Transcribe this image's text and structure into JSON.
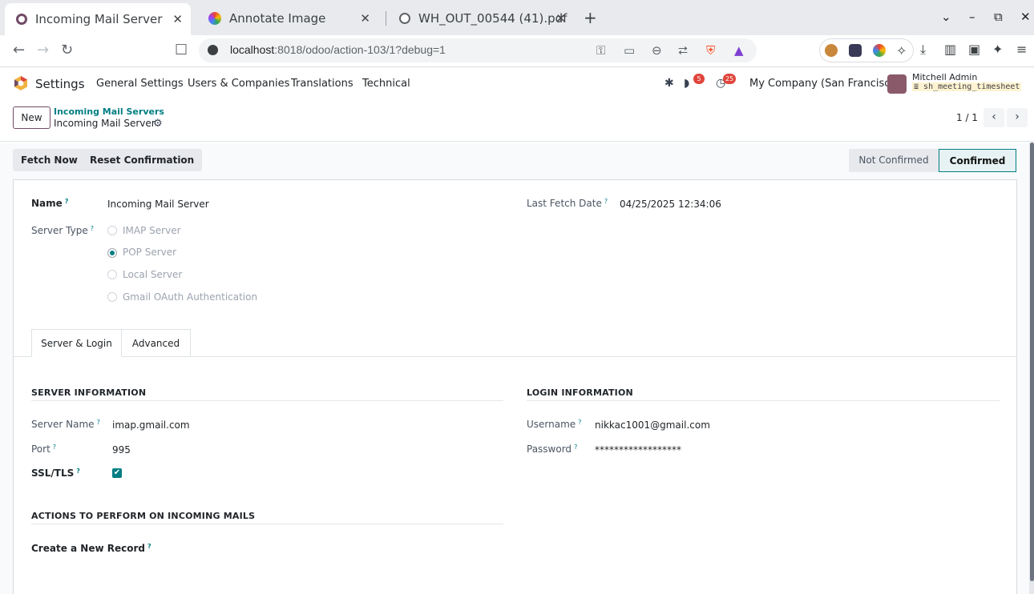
{
  "browser": {
    "tabs": [
      {
        "title": "Incoming Mail Server",
        "close": "✕"
      },
      {
        "title": "Annotate Image",
        "close": "✕"
      },
      {
        "title": "WH_OUT_00544 (41).pdf",
        "close": "✕"
      }
    ],
    "new_tab": "+",
    "window_controls": {
      "menu": "⌄",
      "minimize": "–",
      "maximize": "⧉",
      "close": "✕"
    },
    "url_host": "localhost",
    "url_path": ":8018/odoo/action-103/1?debug=1"
  },
  "odoo_nav": {
    "app_name": "Settings",
    "menu": [
      "General Settings",
      "Users & Companies",
      "Translations",
      "Technical"
    ],
    "messages_badge": "5",
    "activities_badge": "25",
    "company": "My Company (San Francisco)",
    "user_name": "Mitchell Admin",
    "database": "sh_meeting_timesheet"
  },
  "control_panel": {
    "new_label": "New",
    "breadcrumb_parent": "Incoming Mail Servers",
    "breadcrumb_current": "Incoming Mail Server",
    "pager_value": "1 / 1"
  },
  "header": {
    "buttons": [
      "Fetch Now",
      "Reset Confirmation"
    ],
    "statuses": [
      "Not Confirmed",
      "Confirmed"
    ],
    "active_status": "Confirmed"
  },
  "form": {
    "name_label": "Name",
    "name_value": "Incoming Mail Server",
    "last_fetch_label": "Last Fetch Date",
    "last_fetch_value": "04/25/2025 12:34:06",
    "server_type_label": "Server Type",
    "server_type_options": [
      "IMAP Server",
      "POP Server",
      "Local Server",
      "Gmail OAuth Authentication"
    ],
    "server_type_selected": "POP Server",
    "help_mark": "?"
  },
  "tabs": [
    "Server & Login",
    "Advanced"
  ],
  "server_info": {
    "title": "SERVER INFORMATION",
    "server_name_label": "Server Name",
    "server_name_value": "imap.gmail.com",
    "port_label": "Port",
    "port_value": "995",
    "ssl_label": "SSL/TLS",
    "ssl_checked": true
  },
  "login_info": {
    "title": "LOGIN INFORMATION",
    "username_label": "Username",
    "username_value": "nikkac1001@gmail.com",
    "password_label": "Password",
    "password_value": "******************"
  },
  "actions": {
    "title": "ACTIONS TO PERFORM ON INCOMING MAILS",
    "create_record_label": "Create a New Record"
  },
  "colors": {
    "primary": "#714b67",
    "accent": "#017e84",
    "badge": "#e0453b"
  }
}
